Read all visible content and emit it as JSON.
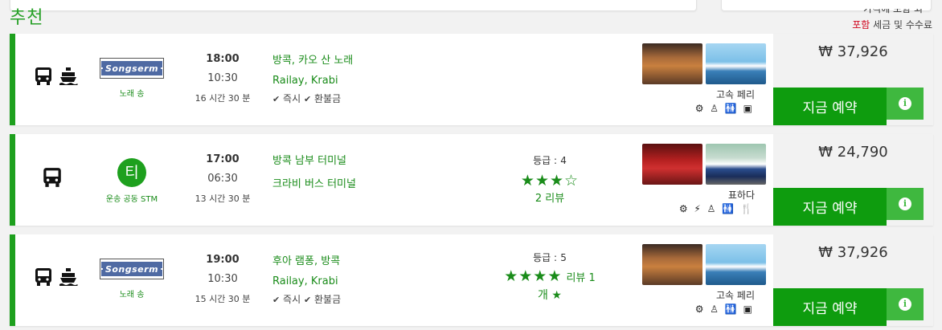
{
  "header": {
    "section_title": "추천",
    "top_note_partial": "가격에 포함 되",
    "tax_included": "포함",
    "tax_rest": " 세금 및 수수료"
  },
  "colors": {
    "accent": "#1ea01e",
    "book": "#0e9c0e",
    "info": "#3fb83f",
    "red": "#d0021b"
  },
  "trips": [
    {
      "modes": [
        "bus-icon",
        "ferry-icon"
      ],
      "operator": {
        "logo_text": "Songserm",
        "name": "노래 송"
      },
      "departure": "18:00",
      "arrival": "10:30",
      "duration": "16 시간 30 분",
      "from": "방콕, 카오 산 노래",
      "to": "Railay, Krabi",
      "flags": [
        "즉시",
        "환불금"
      ],
      "photos": [
        "bus-interior",
        "ferry"
      ],
      "class": "고속 페리",
      "amenities": [
        "gear-icon",
        "toilet-icon",
        "restroom-icon",
        "tv-icon"
      ],
      "price": "₩ 37,926",
      "book_label": "지금 예약",
      "info_label": "i"
    },
    {
      "modes": [
        "bus-icon"
      ],
      "operator": {
        "logo_text": "티",
        "name": "운송 공동 STM"
      },
      "departure": "17:00",
      "arrival": "06:30",
      "duration": "13 시간 30 분",
      "from": "방콕 남부 터미널",
      "to": "크라비 버스 터미널",
      "rating": {
        "label": "등급 :",
        "value": "4",
        "stars": "★★★☆",
        "reviews": "2 리뷰"
      },
      "photos": [
        "red-seats",
        "coach"
      ],
      "class": "표하다",
      "amenities": [
        "gear-icon",
        "power-icon",
        "toilet-icon",
        "restroom-icon",
        "meal-icon"
      ],
      "price": "₩ 24,790",
      "book_label": "지금 예약",
      "info_label": "i"
    },
    {
      "modes": [
        "bus-icon",
        "ferry-icon"
      ],
      "operator": {
        "logo_text": "Songserm",
        "name": "노래 송"
      },
      "departure": "19:00",
      "arrival": "10:30",
      "duration": "15 시간 30 분",
      "from": "후아 램퐁, 방콕",
      "to": "Railay, Krabi",
      "flags": [
        "즉시",
        "환불금"
      ],
      "rating": {
        "label": "등급 :",
        "value": "5",
        "stars": "★★★★",
        "reviews": "리뷰 1",
        "reviews_line2": "개 ★"
      },
      "photos": [
        "bus-interior",
        "ferry"
      ],
      "class": "고속 페리",
      "amenities": [
        "gear-icon",
        "toilet-icon",
        "restroom-icon",
        "tv-icon"
      ],
      "price": "₩ 37,926",
      "book_label": "지금 예약",
      "info_label": "i"
    }
  ]
}
